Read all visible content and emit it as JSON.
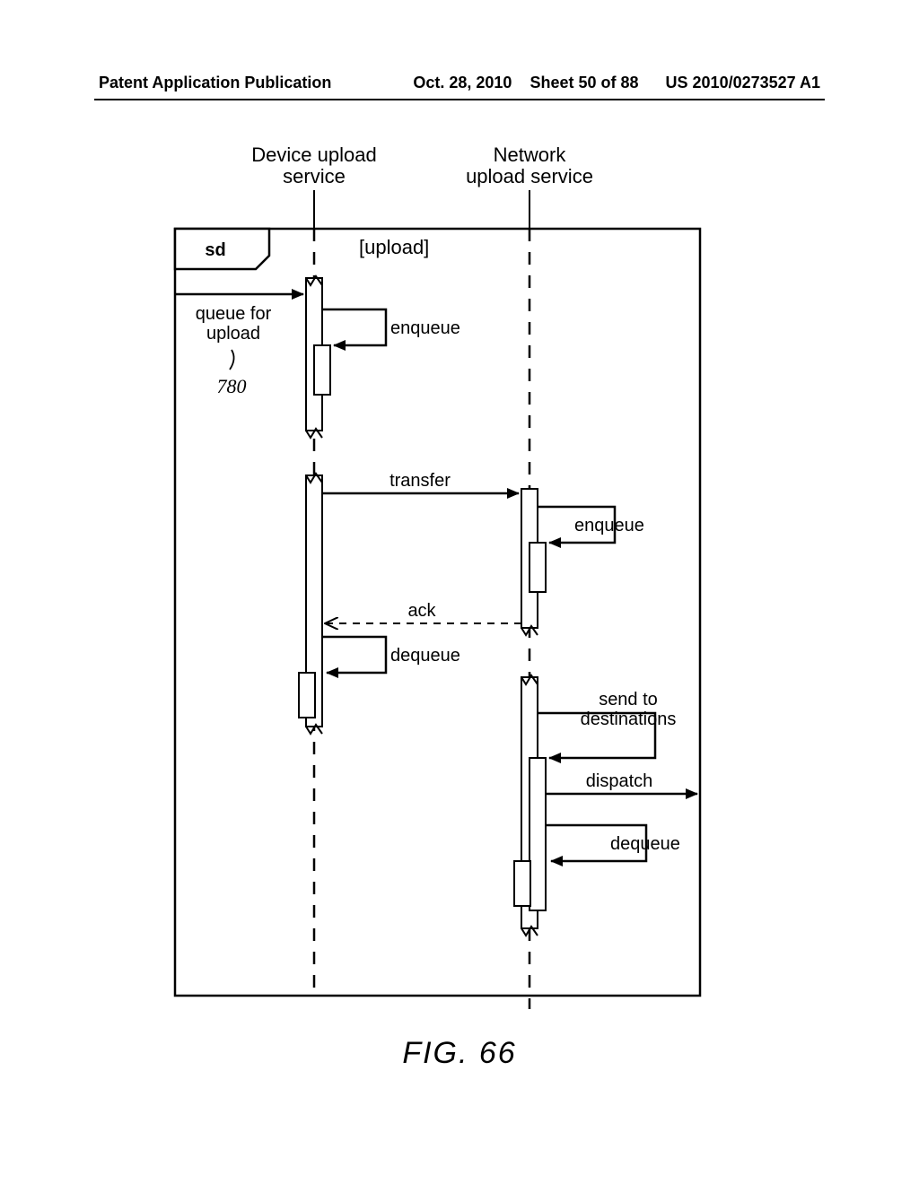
{
  "header": {
    "left": "Patent Application Publication",
    "date": "Oct. 28, 2010",
    "sheet": "Sheet 50 of 88",
    "pubno": "US 2010/0273527 A1"
  },
  "figure_label": "FIG. 66",
  "chart_data": {
    "type": "sequence-diagram",
    "title": "sd",
    "condition": "[upload]",
    "lifelines": [
      {
        "name": "Device upload service"
      },
      {
        "name": "Network upload service"
      }
    ],
    "reference_number": "780",
    "reference_label": "queue for upload",
    "messages": [
      {
        "label": "queue for upload",
        "from": "external",
        "to": "Device upload service",
        "type": "sync"
      },
      {
        "label": "enqueue",
        "from": "Device upload service",
        "to": "Device upload service",
        "type": "self"
      },
      {
        "label": "transfer",
        "from": "Device upload service",
        "to": "Network upload service",
        "type": "sync"
      },
      {
        "label": "enqueue",
        "from": "Network upload service",
        "to": "Network upload service",
        "type": "self"
      },
      {
        "label": "ack",
        "from": "Network upload service",
        "to": "Device upload service",
        "type": "return"
      },
      {
        "label": "dequeue",
        "from": "Device upload service",
        "to": "Device upload service",
        "type": "self"
      },
      {
        "label": "send to destinations",
        "from": "Network upload service",
        "to": "Network upload service",
        "type": "self"
      },
      {
        "label": "dispatch",
        "from": "Network upload service",
        "to": "external",
        "type": "sync"
      },
      {
        "label": "dequeue",
        "from": "Network upload service",
        "to": "Network upload service",
        "type": "self"
      }
    ]
  },
  "labels": {
    "lifeline1_l1": "Device upload",
    "lifeline1_l2": "service",
    "lifeline2_l1": "Network",
    "lifeline2_l2": "upload service",
    "sd": "sd",
    "upload_cond": "[upload]",
    "queue_l1": "queue for",
    "queue_l2": "upload",
    "refnum": "780",
    "enqueue1": "enqueue",
    "transfer": "transfer",
    "enqueue2": "enqueue",
    "ack": "ack",
    "dequeue1": "dequeue",
    "sendto_l1": "send to",
    "sendto_l2": "destinations",
    "dispatch": "dispatch",
    "dequeue2": "dequeue"
  }
}
